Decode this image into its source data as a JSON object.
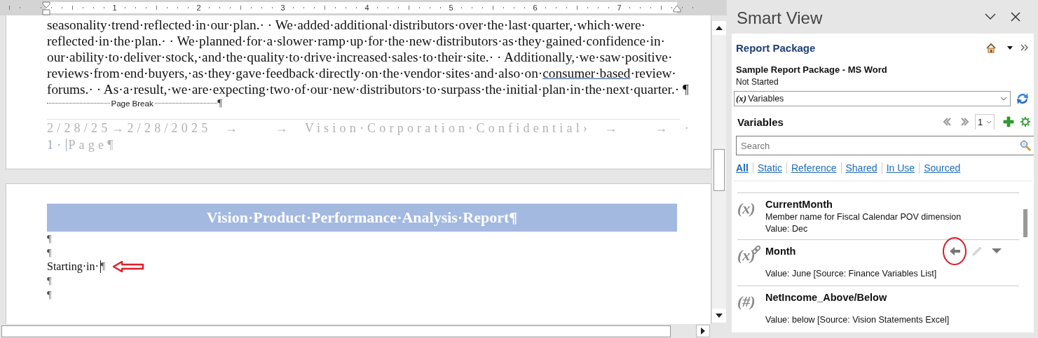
{
  "ruler": {
    "labels": [
      "1",
      "2",
      "3",
      "4",
      "5",
      "6",
      "7"
    ]
  },
  "page_1": {
    "paragraph": [
      [
        {
          "text": "seasonality·trend·reflected·in·our·plan.· · We·added·additional·distributors·over·the·last·quarter,·which·were·",
          "underlined": false
        }
      ],
      [
        {
          "text": "reflected·in·the·plan.· · We·planned·for·a·slower·ramp·up·for·the·new·distributors·as·they·gained·confidence·in·",
          "underlined": false
        }
      ],
      [
        {
          "text": "our·ability·to·deliver·stock,·and·the·quality·to·drive·increased·sales·to·their·site.· · Additionally,·we·saw·positive·",
          "underlined": false
        }
      ],
      [
        {
          "text": "reviews·from·end·buyers,·as·they·gave·feedback·directly·on·the·vendor·sites·and·also·on·",
          "underlined": false
        },
        {
          "text": "consumer·based",
          "underlined": true
        },
        {
          "text": "·review·",
          "underlined": false
        }
      ],
      [
        {
          "text": "forums.· · As·a·result,·we·are·expecting·two·of·our·new·distributors·to·surpass·the·initial·plan·in·the·next·quarter.· ¶",
          "underlined": false
        }
      ]
    ],
    "page_break": {
      "label": "Page Break",
      "mark": "¶"
    },
    "footer": {
      "line": "2/28/25→2/28/2025  →     →  Vision·Corporation·Confidential›  →     →  ·",
      "page_number": "1·",
      "page_label": "Page¶"
    }
  },
  "page_2": {
    "banner": "Vision·Product·Performance·Analysis·Report¶",
    "lines": [
      {
        "kind": "blank",
        "text": "¶"
      },
      {
        "kind": "blank",
        "text": "¶"
      },
      {
        "kind": "body",
        "text": "Starting·in·",
        "end_mark": "¶",
        "annotated": true
      },
      {
        "kind": "blank",
        "text": "¶"
      },
      {
        "kind": "blank",
        "text": "¶"
      }
    ]
  },
  "panel": {
    "title": "Smart View",
    "section": {
      "title": "Report Package"
    },
    "package": {
      "name": "Sample Report Package - MS Word",
      "status": "Not Started"
    },
    "view_select": {
      "icon": "(x)",
      "value": "Variables"
    },
    "variables": {
      "heading": "Variables",
      "page": "1",
      "search": {
        "placeholder": "Search"
      },
      "filters": [
        {
          "label": "All",
          "selected": true
        },
        {
          "label": "Static",
          "selected": false
        },
        {
          "label": "Reference",
          "selected": false
        },
        {
          "label": "Shared",
          "selected": false
        },
        {
          "label": "In Use",
          "selected": false
        },
        {
          "label": "Sourced",
          "selected": false
        }
      ],
      "items": [
        {
          "kind": "variable",
          "icon": "(x)",
          "name": "CurrentMonth",
          "description": "Member name for Fiscal Calendar POV dimension",
          "value": "Value: Dec",
          "hovered": false
        },
        {
          "kind": "linked",
          "icon": "(x)",
          "name": "Month",
          "value": "Value: June [Source: Finance Variables List]",
          "hovered": true
        },
        {
          "kind": "number",
          "icon": "(#)",
          "name": "NetIncome_Above/Below",
          "value": "Value: below [Source: Vision Statements Excel]",
          "hovered": false
        }
      ]
    }
  }
}
